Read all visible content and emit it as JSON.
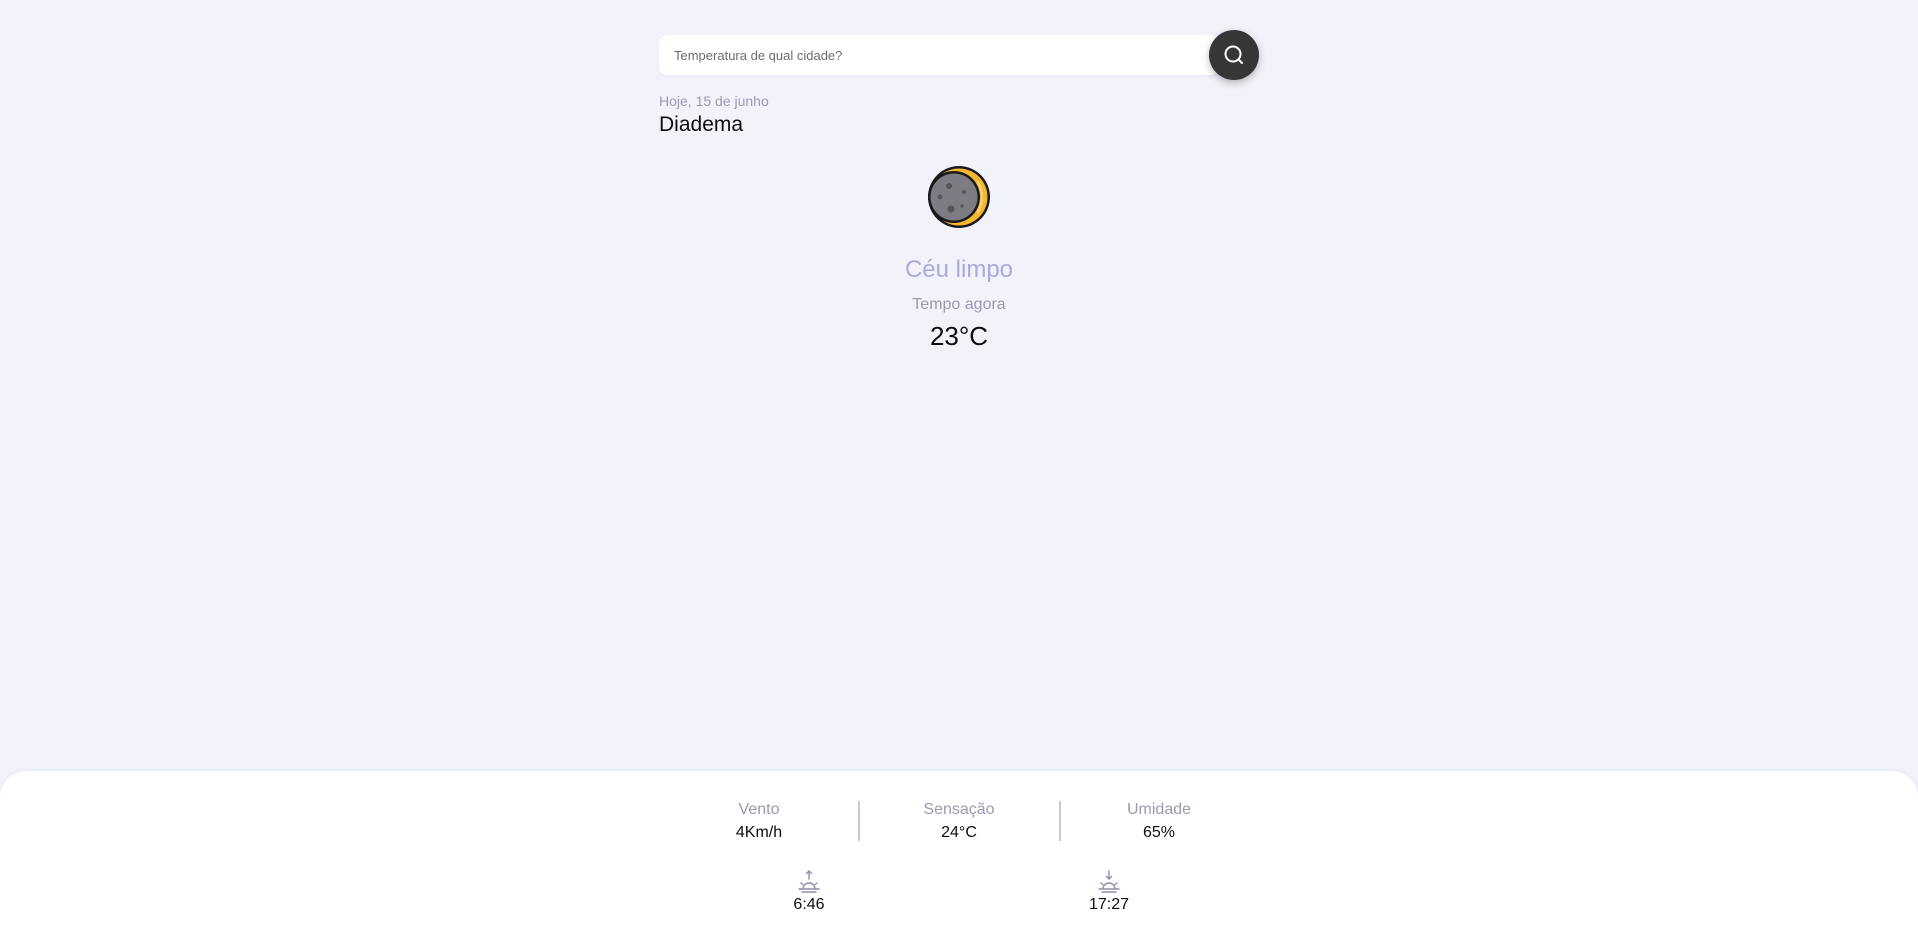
{
  "search": {
    "placeholder": "Temperatura de qual cidade?",
    "value": "",
    "button_icon": "search-icon"
  },
  "header": {
    "date": "Hoje, 15 de junho",
    "city": "Diadema"
  },
  "current": {
    "icon": "crescent-moon-icon",
    "condition": "Céu limpo",
    "label": "Tempo agora",
    "temperature": "23°C"
  },
  "details": {
    "wind": {
      "label": "Vento",
      "value": "4Km/h"
    },
    "feels_like": {
      "label": "Sensação",
      "value": "24°C"
    },
    "humidity": {
      "label": "Umidade",
      "value": "65%"
    }
  },
  "sun": {
    "sunrise": {
      "icon": "sunrise-icon",
      "time": "6:46"
    },
    "sunset": {
      "icon": "sunset-icon",
      "time": "17:27"
    }
  },
  "colors": {
    "background": "#f1f2fa",
    "accent": "#aaaade",
    "search_button": "#363636",
    "muted_text": "#9a9ab0",
    "moon_yellow": "#f5b731",
    "moon_grey": "#7c7c84"
  }
}
